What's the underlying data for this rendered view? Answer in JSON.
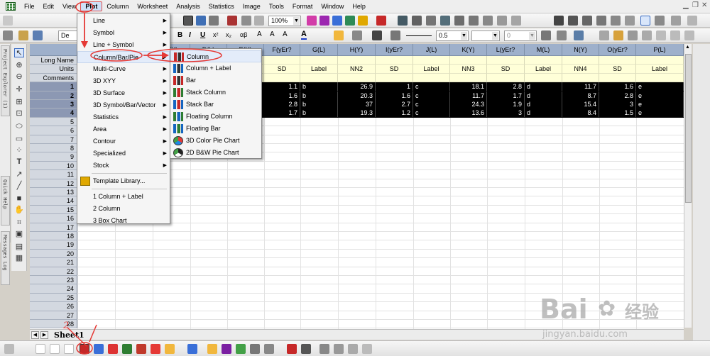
{
  "menubar": {
    "items": [
      "File",
      "Edit",
      "View",
      "Plot",
      "Column",
      "Worksheet",
      "Analysis",
      "Statistics",
      "Image",
      "Tools",
      "Format",
      "Window",
      "Help"
    ],
    "active": "Plot"
  },
  "toolbar": {
    "zoom": "100%",
    "font_name": "De",
    "font_size": "0.5",
    "line_width": "0",
    "icons": {
      "bold": "B",
      "italic": "I",
      "underline": "U",
      "superscript": "x²",
      "subscript": "x₂",
      "greek": "αβ",
      "font_color": "A"
    }
  },
  "side_tabs": [
    "Project Explorer (1)",
    "Quick Help",
    "Messages Log"
  ],
  "worksheet": {
    "columns": [
      {
        "name": "F(yEr?",
        "units": "SD"
      },
      {
        "name": "G(L)",
        "units": "Label"
      },
      {
        "name": "H(Y)",
        "units": "NN2"
      },
      {
        "name": "I(yEr?",
        "units": "SD"
      },
      {
        "name": "J(L)",
        "units": "Label"
      },
      {
        "name": "K(Y)",
        "units": "NN3"
      },
      {
        "name": "L(yEr?",
        "units": "SD"
      },
      {
        "name": "M(L)",
        "units": "Label"
      },
      {
        "name": "N(Y)",
        "units": "NN4"
      },
      {
        "name": "O(yEr?",
        "units": "SD"
      },
      {
        "name": "P(L)",
        "units": "Label"
      }
    ],
    "hidden_headers": [
      "C(Y)",
      "D(L)",
      "E(Y)"
    ],
    "meta_rows": [
      "Long Name",
      "Units",
      "Comments"
    ],
    "row_numbers": [
      "1",
      "2",
      "3",
      "4",
      "5",
      "6",
      "7",
      "8",
      "9",
      "10",
      "11",
      "12",
      "13",
      "14",
      "15",
      "16",
      "17",
      "18",
      "19",
      "20",
      "21",
      "22",
      "23",
      "24",
      "25",
      "26",
      "27",
      "28"
    ],
    "data": [
      [
        "1.1",
        "b",
        "26.9",
        "1",
        "c",
        "18.1",
        "2.8",
        "d",
        "11.7",
        "1.6",
        "e"
      ],
      [
        "1.6",
        "b",
        "20.3",
        "1.6",
        "c",
        "11.7",
        "1.7",
        "d",
        "8.7",
        "2.8",
        "e"
      ],
      [
        "2.8",
        "b",
        "37",
        "2.7",
        "c",
        "24.3",
        "1.9",
        "d",
        "15.4",
        "3",
        "e"
      ],
      [
        "1.7",
        "b",
        "19.3",
        "1.2",
        "c",
        "13.6",
        "3",
        "d",
        "8.4",
        "1.5",
        "e"
      ]
    ],
    "sheet_tab": "Sheet1"
  },
  "plot_menu": {
    "items": [
      "Line",
      "Symbol",
      "Line + Symbol",
      "Column/Bar/Pie",
      "Multi-Curve",
      "3D XYY",
      "3D Surface",
      "3D Symbol/Bar/Vector",
      "Statistics",
      "Area",
      "Contour",
      "Specialized",
      "Stock",
      "Template Library...",
      "1 Column + Label",
      "2 Column",
      "3 Box Chart"
    ],
    "highlighted": "Column/Bar/Pie"
  },
  "submenu": {
    "items": [
      "Column",
      "Column + Label",
      "Bar",
      "Stack Column",
      "Stack Bar",
      "Floating Column",
      "Floating Bar",
      "3D Color Pie Chart",
      "2D B&W Pie Chart"
    ],
    "highlighted": "Column"
  },
  "annotations": {
    "step_number": "2"
  },
  "watermark": {
    "brand": "Bai",
    "brand2": "百",
    "suffix": "经验",
    "url": "jingyan.baidu.com"
  },
  "colors": {
    "selection": "#000000",
    "header": "#9eb0cb",
    "meta": "#ffffd8",
    "annotation": "#e53935"
  }
}
